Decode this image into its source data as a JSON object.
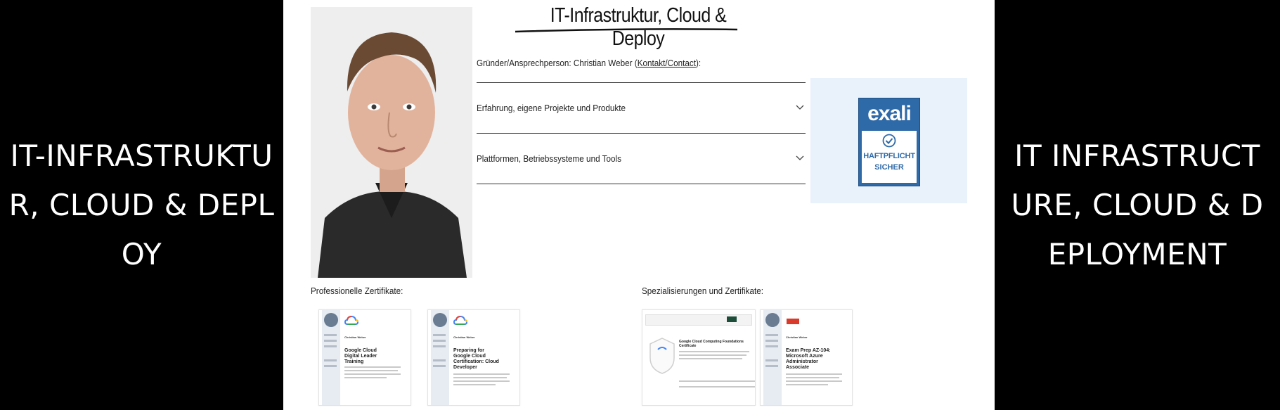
{
  "left_banner": {
    "text": "IT-INFRASTRUKTUR, CLOUD & DEPLOY"
  },
  "right_banner": {
    "text": "IT INFRASTRUCTURE, CLOUD & DEPLOYMENT"
  },
  "page": {
    "title": "IT-Infrastruktur, Cloud & Deploy",
    "contact": {
      "prefix": "Gründer/Ansprechperson: Christian Weber (",
      "link": "Kontakt/Contact",
      "suffix": "):"
    },
    "accordion": [
      {
        "label": "Erfahrung, eigene Projekte und Produkte"
      },
      {
        "label": "Plattformen, Betriebssysteme und Tools"
      }
    ],
    "badge": {
      "brand": "exali",
      "line1": "HAFTPFLICHT",
      "line2": "SICHER"
    },
    "sections": {
      "professional": "Professionelle Zertifikate:",
      "specializations": "Spezialisierungen und Zertifikate:"
    },
    "certificates": [
      {
        "name": "Christian Weber",
        "title": "Google Cloud Digital Leader Training"
      },
      {
        "name": "Christian Weber",
        "title": "Preparing for Google Cloud Certification: Cloud Developer"
      },
      {
        "title": "Google Cloud Computing Foundations Certificate"
      },
      {
        "name": "Christian Weber",
        "title": "Exam Prep AZ-104: Microsoft Azure Administrator Associate"
      }
    ]
  },
  "colors": {
    "accent_blue": "#2f6aa8",
    "badge_bg": "#e9f1fb",
    "background_side": "#000000"
  }
}
